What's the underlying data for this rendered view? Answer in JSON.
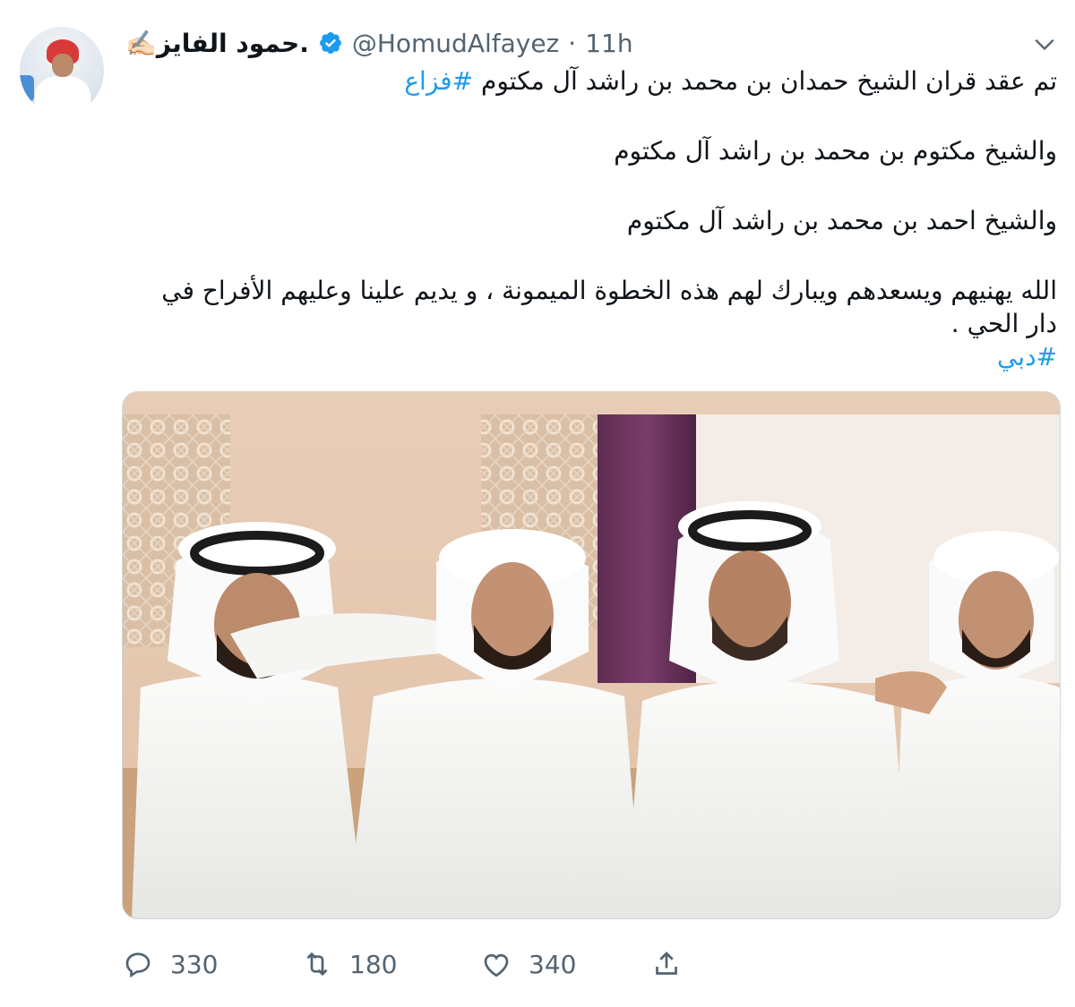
{
  "tweet": {
    "author_name": ".حمود الفايز",
    "author_emoji": "✍🏻",
    "handle": "@HomudAlfayez",
    "separator": "·",
    "time": "11h",
    "text": {
      "line1": "تم عقد قران الشيخ حمدان بن محمد بن راشد آل مكتوم ",
      "line1_hashtag": "#فزاع",
      "line2": "والشيخ مكتوم بن محمد بن راشد آل مكتوم",
      "line3": "والشيخ احمد بن محمد بن راشد آل مكتوم",
      "line4": "الله يهنيهم ويسعدهم ويبارك لهم هذه الخطوة الميمونة ، و يديم علينا وعليهم الأفراح في دار الحي .",
      "hashtag2": "#دبي"
    },
    "stats": {
      "replies": "330",
      "retweets": "180",
      "likes": "340"
    }
  },
  "icons": {
    "verified": "verified-badge-icon",
    "more": "chevron-down-icon",
    "reply": "reply-icon",
    "retweet": "retweet-icon",
    "like": "heart-icon",
    "share": "share-icon"
  },
  "colors": {
    "accent": "#1d9bf0",
    "secondary_text": "#536471"
  }
}
